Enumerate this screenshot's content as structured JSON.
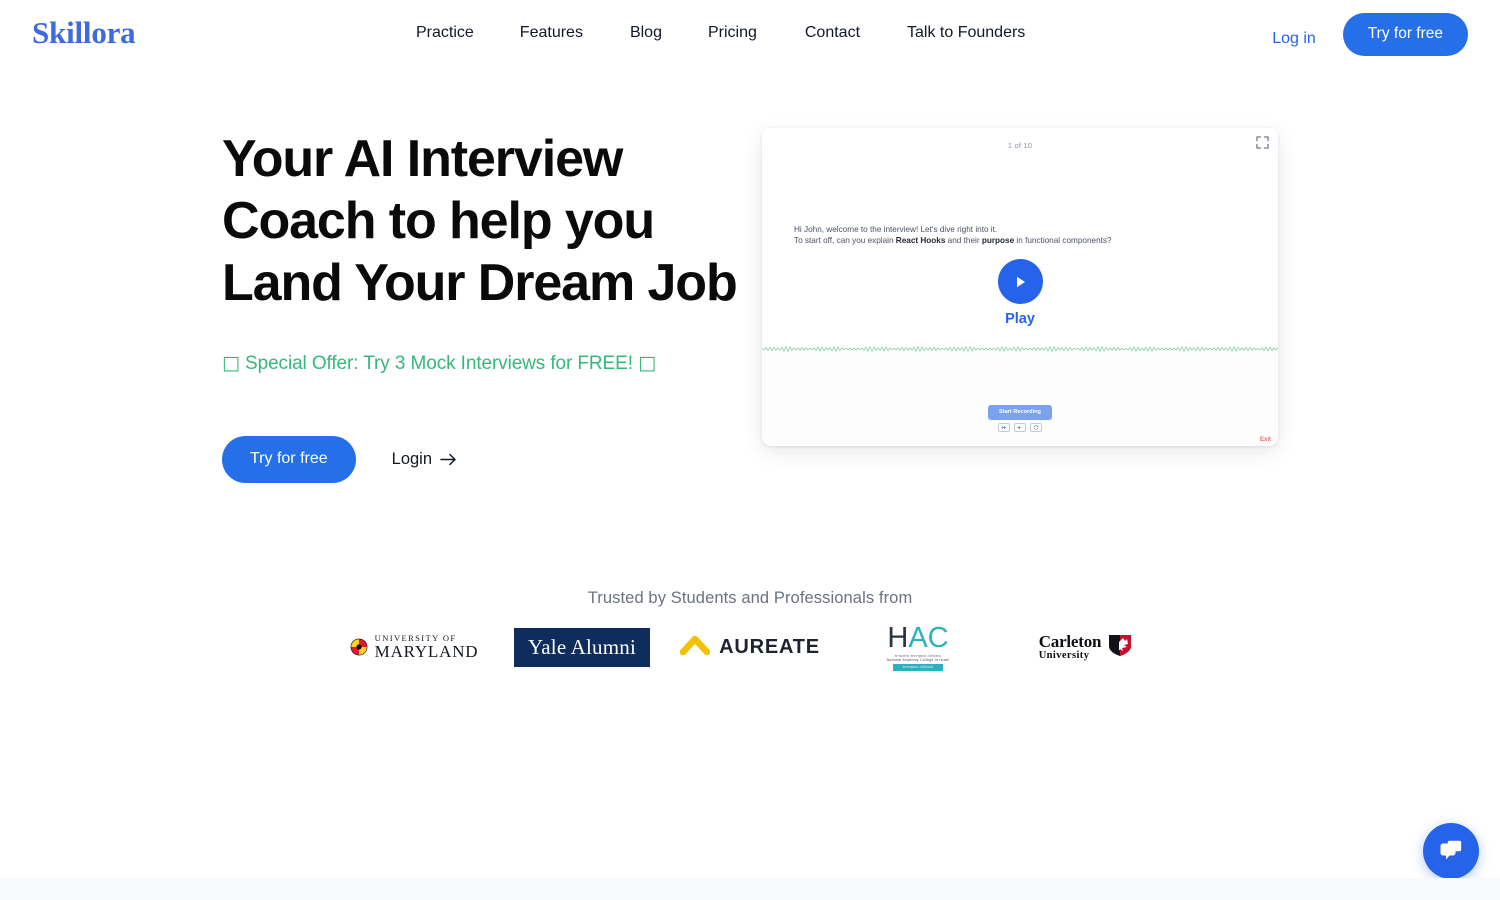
{
  "brand": {
    "name": "Skillora",
    "accent": "#2563eb"
  },
  "nav": {
    "links": [
      {
        "label": "Practice"
      },
      {
        "label": "Features"
      },
      {
        "label": "Blog"
      },
      {
        "label": "Pricing"
      },
      {
        "label": "Contact"
      },
      {
        "label": "Talk to Founders"
      }
    ],
    "login_label": "Log in",
    "try_label": "Try for free"
  },
  "hero": {
    "headline_line1": "Your AI Interview",
    "headline_line2": "Coach to help you",
    "headline_line3": "Land Your Dream Job",
    "offer_text": "Special Offer: Try 3 Mock Interviews for FREE!",
    "offer_glyph_left": "□",
    "offer_glyph_right": "□",
    "offer_color": "#35b87c",
    "cta_primary": "Try for free",
    "cta_secondary": "Login"
  },
  "demo": {
    "counter": "1 of 10",
    "question_line1": "Hi John, welcome to the interview! Let's dive right into it.",
    "question_line2_pre": "To start off, can you explain ",
    "question_line2_b1": "React Hooks",
    "question_line2_mid": " and their ",
    "question_line2_b2": "purpose",
    "question_line2_post": " in functional components?",
    "play_label": "Play",
    "record_label": "Start Recording",
    "exit_label": "Exit",
    "wave_color": "#7bc49a"
  },
  "trust": {
    "label": "Trusted by Students and Professionals from",
    "logos": [
      {
        "name": "University of Maryland",
        "line1": "UNIVERSITY OF",
        "line2": "MARYLAND"
      },
      {
        "name": "Yale Alumni",
        "text": "Yale Alumni"
      },
      {
        "name": "Aureate",
        "text": "AUREATE"
      },
      {
        "name": "HAC",
        "h": "H",
        "ac": "AC",
        "sub1": "המכללה האקדמית הלאומית",
        "sub2": "National Academy College of Israel",
        "bar": "המכללה האקדמית"
      },
      {
        "name": "Carleton University",
        "line1": "Carleton",
        "line2": "University"
      }
    ]
  },
  "chat": {
    "aria_label": "Open chat"
  }
}
